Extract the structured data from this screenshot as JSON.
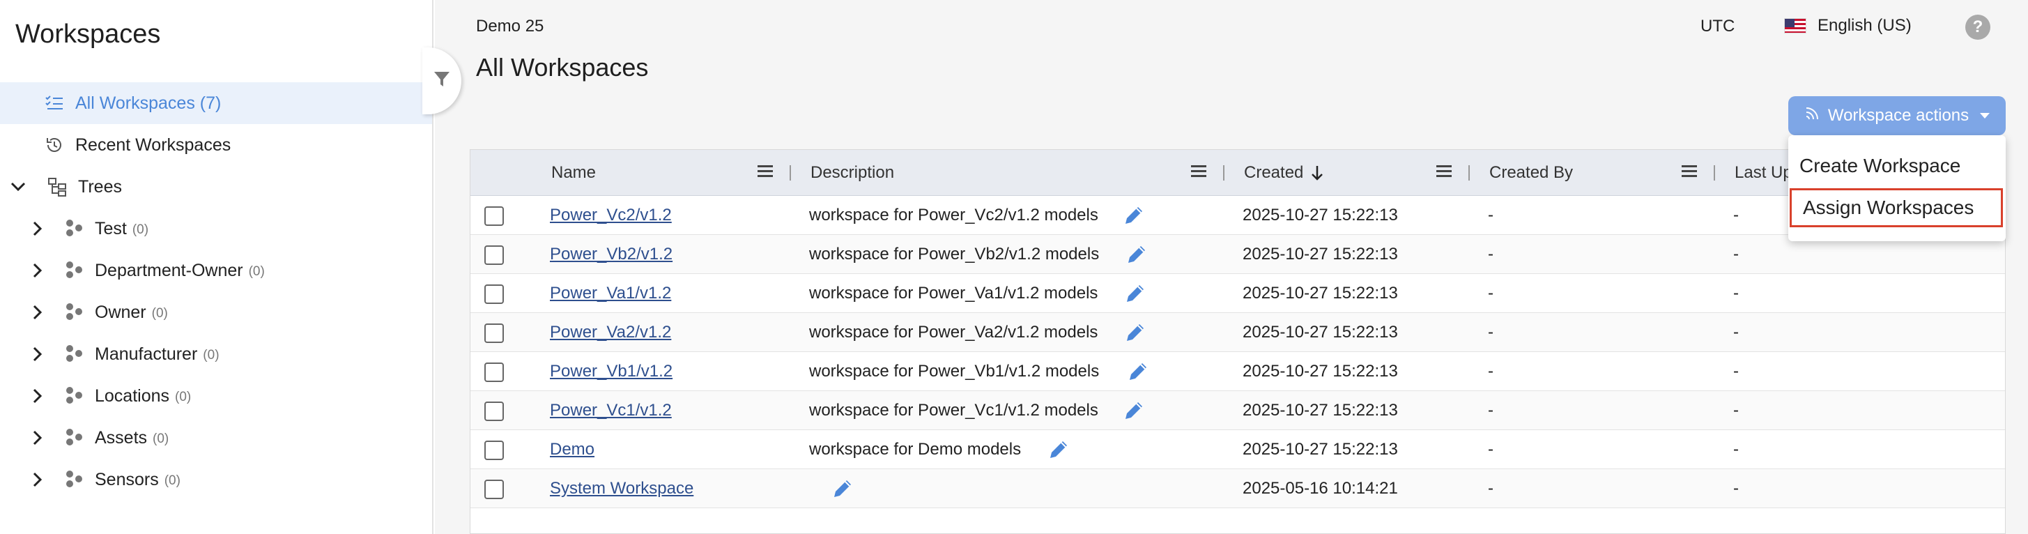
{
  "sidebar": {
    "title": "Workspaces",
    "items": [
      {
        "label": "All Workspaces (7)"
      },
      {
        "label": "Recent Workspaces"
      },
      {
        "label": "Trees"
      }
    ],
    "trees": [
      {
        "label": "Test",
        "count": "(0)"
      },
      {
        "label": "Department-Owner",
        "count": "(0)"
      },
      {
        "label": "Owner",
        "count": "(0)"
      },
      {
        "label": "Manufacturer",
        "count": "(0)"
      },
      {
        "label": "Locations",
        "count": "(0)"
      },
      {
        "label": "Assets",
        "count": "(0)"
      },
      {
        "label": "Sensors",
        "count": "(0)"
      }
    ]
  },
  "header": {
    "tenant": "Demo 25",
    "timezone": "UTC",
    "language": "English (US)",
    "help": "?",
    "page_title": "All Workspaces"
  },
  "actions": {
    "button_label": "Workspace actions",
    "menu": [
      "Create Workspace",
      "Assign Workspaces"
    ]
  },
  "table": {
    "columns": [
      "Name",
      "Description",
      "Created",
      "Created By",
      "Last Up"
    ],
    "sort": {
      "column": "Created",
      "direction": "descending"
    },
    "rows": [
      {
        "name": "Power_Vc2/v1.2",
        "description": "workspace for Power_Vc2/v1.2 models",
        "created": "2025-10-27 15:22:13",
        "created_by": "-",
        "last_updated": "-"
      },
      {
        "name": "Power_Vb2/v1.2",
        "description": "workspace for Power_Vb2/v1.2 models",
        "created": "2025-10-27 15:22:13",
        "created_by": "-",
        "last_updated": "-"
      },
      {
        "name": "Power_Va1/v1.2",
        "description": "workspace for Power_Va1/v1.2 models",
        "created": "2025-10-27 15:22:13",
        "created_by": "-",
        "last_updated": "-"
      },
      {
        "name": "Power_Va2/v1.2",
        "description": "workspace for Power_Va2/v1.2 models",
        "created": "2025-10-27 15:22:13",
        "created_by": "-",
        "last_updated": "-"
      },
      {
        "name": "Power_Vb1/v1.2",
        "description": "workspace for Power_Vb1/v1.2 models",
        "created": "2025-10-27 15:22:13",
        "created_by": "-",
        "last_updated": "-"
      },
      {
        "name": "Power_Vc1/v1.2",
        "description": "workspace for Power_Vc1/v1.2 models",
        "created": "2025-10-27 15:22:13",
        "created_by": "-",
        "last_updated": "-"
      },
      {
        "name": "Demo",
        "description": "workspace for Demo models",
        "created": "2025-10-27 15:22:13",
        "created_by": "-",
        "last_updated": "-"
      },
      {
        "name": "System Workspace",
        "description": "",
        "created": "2025-05-16 10:14:21",
        "created_by": "-",
        "last_updated": "-"
      }
    ]
  },
  "colors": {
    "accent": "#4a86d8",
    "button": "#7ea6e6",
    "highlight_border": "#d9412c"
  }
}
